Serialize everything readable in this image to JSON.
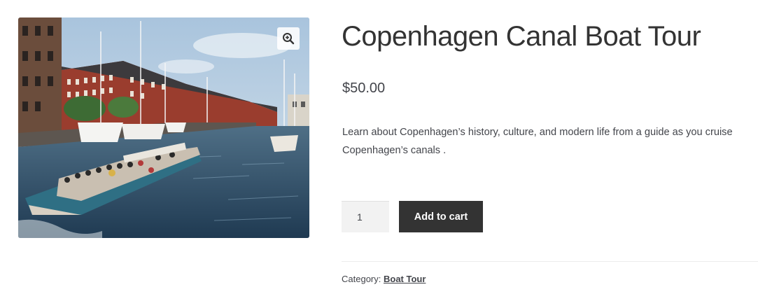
{
  "gallery": {
    "image_alt": "Canal boat full of tourists cruising along a Copenhagen canal lined with sailboats and brick buildings",
    "zoom_icon": "magnify-plus-icon"
  },
  "product": {
    "title": "Copenhagen Canal Boat Tour",
    "price": "$50.00",
    "description": "Learn about Copenhagen’s history, culture, and modern life from a guide as you cruise Copenhagen’s canals ."
  },
  "cart": {
    "quantity": "1",
    "add_to_cart_label": "Add to cart"
  },
  "meta": {
    "category_label": "Category:",
    "category_value": "Boat Tour"
  },
  "colors": {
    "title": "#333333",
    "button_bg": "#333333",
    "button_text": "#ffffff",
    "body_text": "#43454b"
  }
}
